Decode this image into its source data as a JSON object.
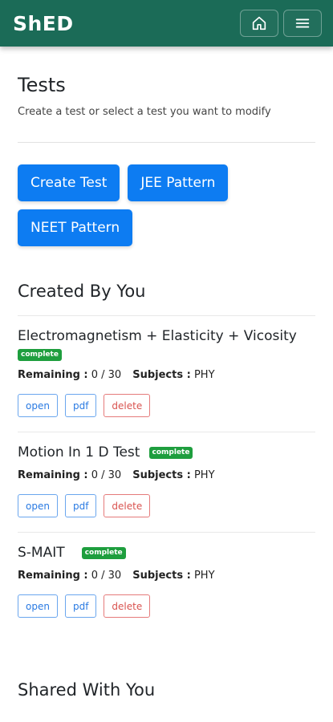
{
  "header": {
    "brand": "ShED",
    "home_icon": "home-icon",
    "menu_icon": "hamburger-menu-icon",
    "color": "#1b6b57"
  },
  "page": {
    "title": "Tests",
    "subtitle": "Create a test or select a test you want to modify",
    "actions": {
      "create": "Create Test",
      "jee": "JEE Pattern",
      "neet": "NEET Pattern"
    }
  },
  "created_section": {
    "title": "Created By You",
    "tests": [
      {
        "name": "Electromagnetism + Elasticity + Vicosity",
        "status": "complete",
        "remaining_label": "Remaining :",
        "remaining_value": "0 / 30",
        "subjects_label": "Subjects :",
        "subjects_value": "PHY",
        "open": "open",
        "pdf": "pdf",
        "delete": "delete"
      },
      {
        "name": "Motion In 1 D Test",
        "status": "complete",
        "remaining_label": "Remaining :",
        "remaining_value": "0 / 30",
        "subjects_label": "Subjects :",
        "subjects_value": "PHY",
        "open": "open",
        "pdf": "pdf",
        "delete": "delete"
      },
      {
        "name": "S-MAIT",
        "status": "complete",
        "remaining_label": "Remaining :",
        "remaining_value": "0 / 30",
        "subjects_label": "Subjects :",
        "subjects_value": "PHY",
        "open": "open",
        "pdf": "pdf",
        "delete": "delete"
      }
    ]
  },
  "shared_section": {
    "title": "Shared With You"
  },
  "colors": {
    "primary": "#0d7cf2",
    "success": "#1e9e3e",
    "danger": "#d9534f"
  }
}
